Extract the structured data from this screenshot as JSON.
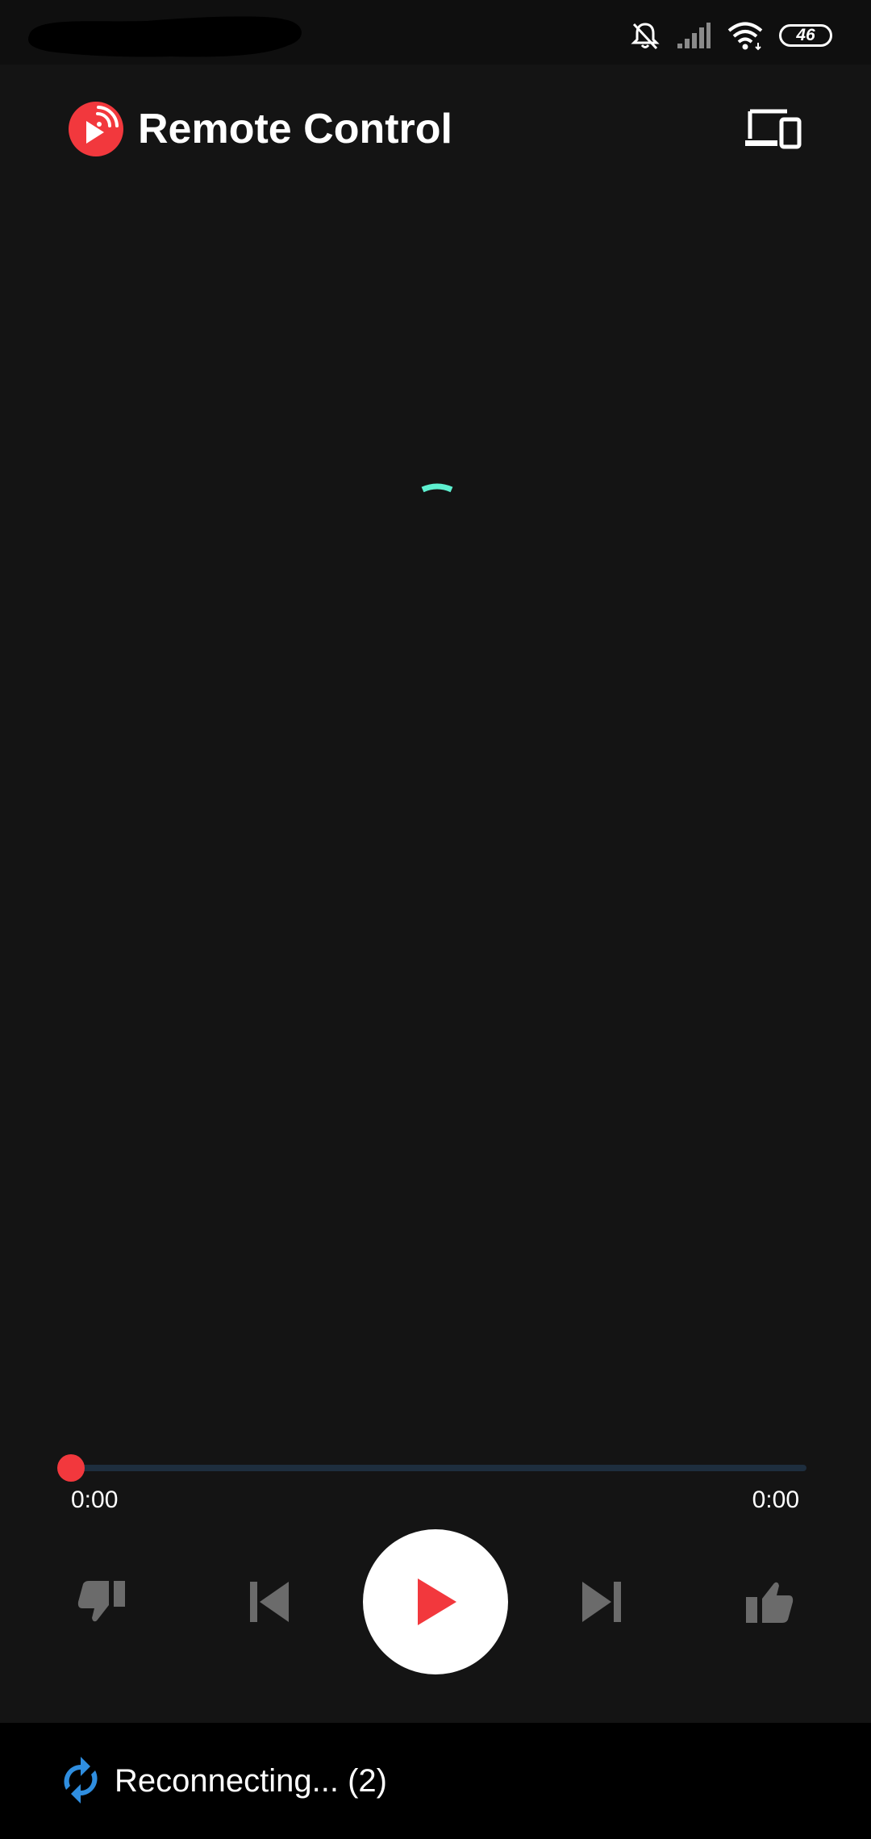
{
  "status_bar": {
    "battery_level": "46",
    "icons": [
      "bell-muted-icon",
      "signal-icon",
      "wifi-icon",
      "battery-icon"
    ]
  },
  "header": {
    "title": "Remote Control",
    "logo_icon": "youtube-music-remote-logo-icon",
    "devices_icon": "devices-icon"
  },
  "player": {
    "loading": true,
    "progress": 0,
    "elapsed": "0:00",
    "total": "0:00",
    "controls": [
      "thumbs-down-icon",
      "skip-previous-icon",
      "play-icon",
      "skip-next-icon",
      "thumbs-up-icon"
    ]
  },
  "connection": {
    "status": "Reconnecting... (2)",
    "icon": "sync-icon"
  },
  "colors": {
    "background": "#141414",
    "accent_red": "#f2383d",
    "spinner": "#5ef0d0",
    "sync_blue": "#2f8ee0",
    "disabled_icon": "#6b6b6b",
    "track": "#1e2e3e"
  }
}
